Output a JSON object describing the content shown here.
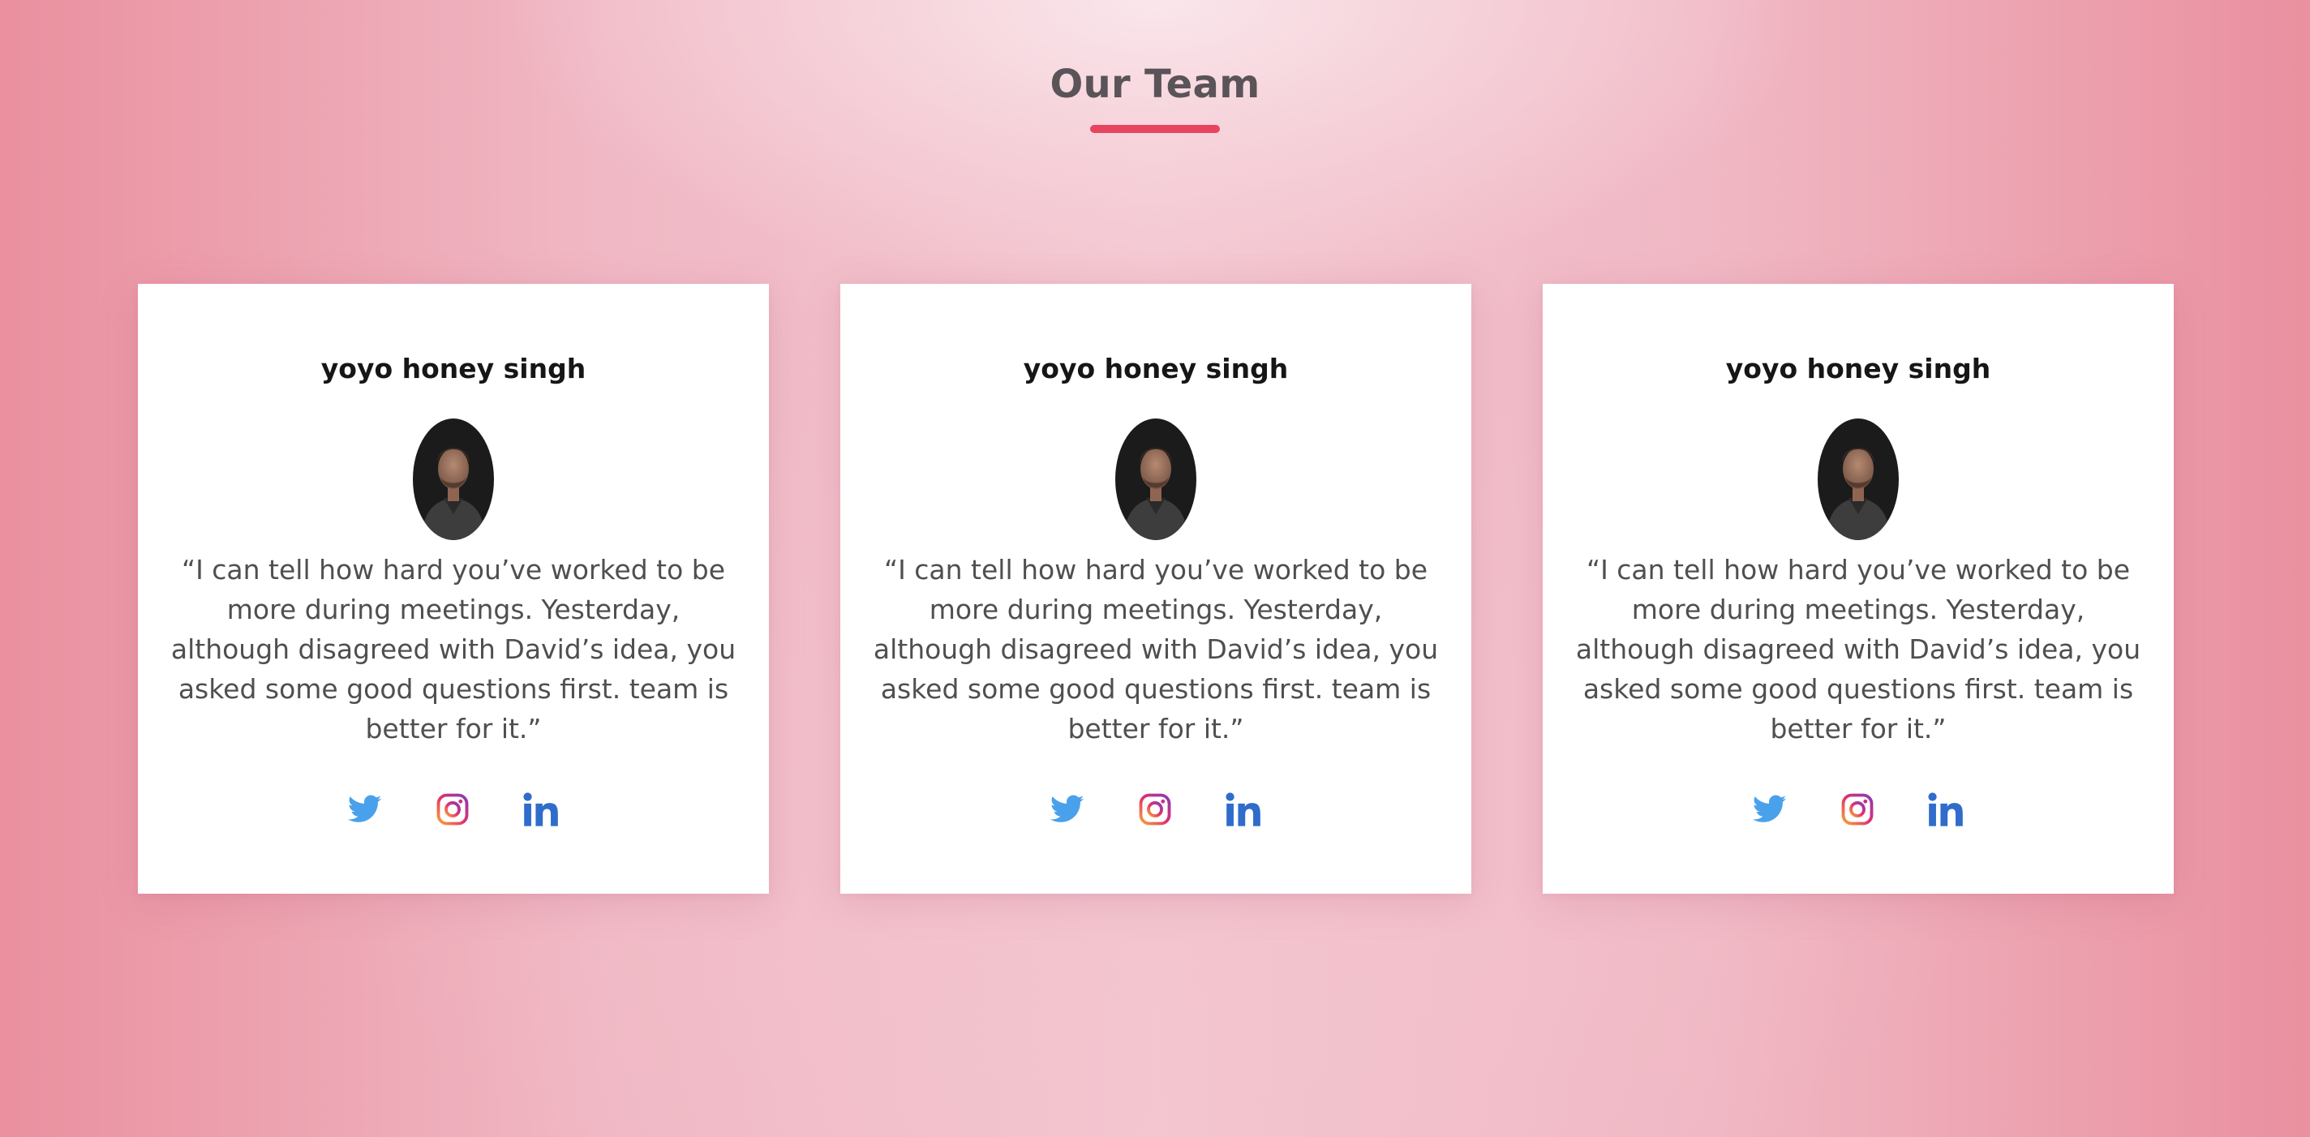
{
  "header": {
    "title": "Our Team"
  },
  "colors": {
    "accent": "#e6455f",
    "twitter": "#4aa1eb",
    "linkedin": "#2f6ccb",
    "instagram_start": "#f9a23a",
    "instagram_mid": "#e1306c",
    "instagram_end": "#8a3ab9"
  },
  "team": [
    {
      "name": "yoyo honey singh",
      "quote": "“I can tell how hard you’ve worked to be more during meetings. Yesterday, although disagreed with David’s idea, you asked some good questions first. team is better for it.”",
      "socials": [
        {
          "icon": "twitter-icon"
        },
        {
          "icon": "instagram-icon"
        },
        {
          "icon": "linkedin-icon"
        }
      ]
    },
    {
      "name": "yoyo honey singh",
      "quote": "“I can tell how hard you’ve worked to be more during meetings. Yesterday, although disagreed with David’s idea, you asked some good questions first. team is better for it.”",
      "socials": [
        {
          "icon": "twitter-icon"
        },
        {
          "icon": "instagram-icon"
        },
        {
          "icon": "linkedin-icon"
        }
      ]
    },
    {
      "name": "yoyo honey singh",
      "quote": "“I can tell how hard you’ve worked to be more during meetings. Yesterday, although disagreed with David’s idea, you asked some good questions first. team is better for it.”",
      "socials": [
        {
          "icon": "twitter-icon"
        },
        {
          "icon": "instagram-icon"
        },
        {
          "icon": "linkedin-icon"
        }
      ]
    }
  ]
}
